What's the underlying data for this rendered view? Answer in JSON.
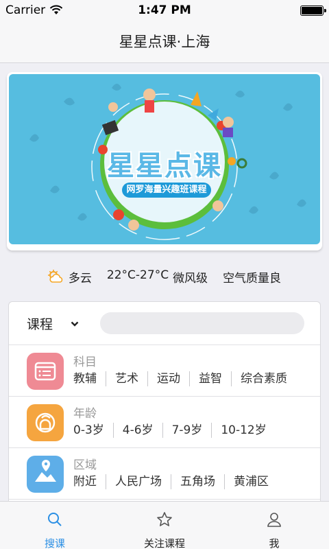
{
  "status_bar": {
    "carrier": "Carrier",
    "time": "1:47 PM"
  },
  "nav": {
    "title": "星星点课·上海"
  },
  "banner": {
    "title": "星星点课",
    "subtitle": "网罗海量兴趣班课程"
  },
  "weather": {
    "icon": "partly-cloudy-icon",
    "condition": "多云",
    "temperature": "22°C-27°C",
    "wind": "微风级",
    "air_quality": "空气质量良"
  },
  "search": {
    "category": "课程",
    "placeholder": ""
  },
  "filters": [
    {
      "icon": "subject-icon",
      "icon_color": "#ef8a94",
      "label": "科目",
      "options": [
        "教辅",
        "艺术",
        "运动",
        "益智",
        "综合素质"
      ]
    },
    {
      "icon": "age-icon",
      "icon_color": "#f5a53f",
      "label": "年龄",
      "options": [
        "0-3岁",
        "4-6岁",
        "7-9岁",
        "10-12岁"
      ]
    },
    {
      "icon": "area-map-icon",
      "icon_color": "#5eaee8",
      "label": "区域",
      "options": [
        "附近",
        "人民广场",
        "五角场",
        "黄浦区"
      ]
    }
  ],
  "tabs": [
    {
      "label": "搜课",
      "icon": "search-icon",
      "active": true
    },
    {
      "label": "关注课程",
      "icon": "star-icon",
      "active": false
    },
    {
      "label": "我",
      "icon": "person-icon",
      "active": false
    }
  ],
  "colors": {
    "accent": "#2b8fe4",
    "banner_bg": "#56bde0"
  }
}
